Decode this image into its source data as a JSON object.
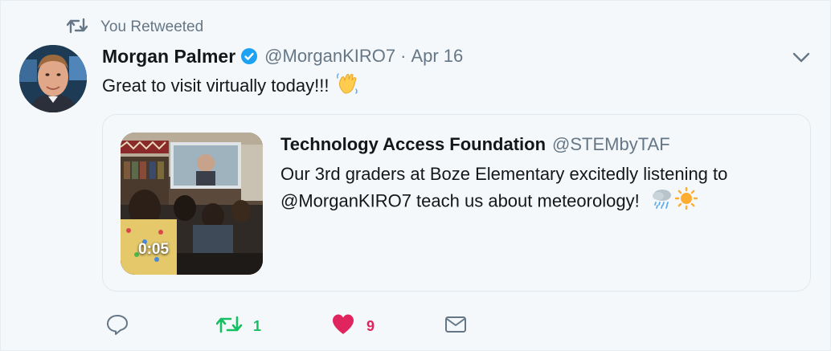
{
  "retweet_context": {
    "label": "You Retweeted",
    "icon": "retweet-icon"
  },
  "tweet": {
    "author_name": "Morgan Palmer",
    "author_handle": "@MorganKIRO7",
    "separator": "·",
    "date": "Apr 16",
    "text": "Great to visit virtually today!!!",
    "text_emoji": "waving-hand-icon",
    "verified": true
  },
  "quoted_tweet": {
    "author_name": "Technology Access Foundation",
    "author_handle": "@STEMbyTAF",
    "text": "Our 3rd graders at Boze Elementary excitedly listening to @MorganKIRO7 teach us about meteorology!",
    "emojis": [
      "cloud-rain-icon",
      "sun-icon"
    ],
    "video_duration": "0:05"
  },
  "actions": {
    "reply": {
      "icon": "reply-icon",
      "count": ""
    },
    "retweet": {
      "icon": "retweet-icon",
      "count": "1",
      "active": true
    },
    "like": {
      "icon": "heart-icon",
      "count": "9",
      "active": true
    },
    "message": {
      "icon": "envelope-icon"
    }
  },
  "colors": {
    "background": "#f5f8fa",
    "secondary_text": "#657786",
    "verified_blue": "#1da1f2",
    "retweet_green": "#17bf63",
    "like_red": "#e0245e"
  }
}
